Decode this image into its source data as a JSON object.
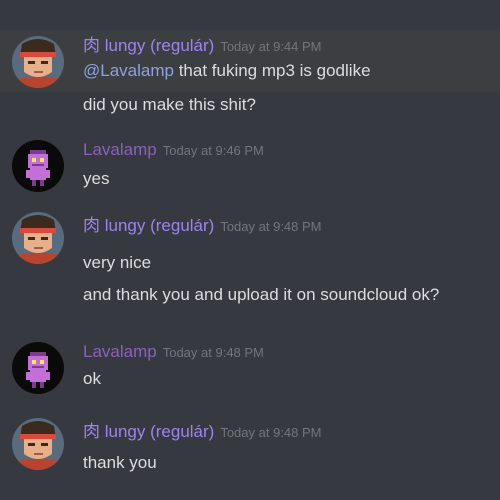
{
  "messages": [
    {
      "author": "肉 lungy (regulár)",
      "timestamp": "Today at 9:44 PM",
      "lines": [
        {
          "mention": "@Lavalamp",
          "text": " that fuking mp3 is godlike"
        },
        {
          "text": "did you make this shit?"
        }
      ]
    },
    {
      "author": "Lavalamp",
      "timestamp": "Today at 9:46 PM",
      "lines": [
        {
          "text": "yes"
        }
      ]
    },
    {
      "author": "肉 lungy (regulár)",
      "timestamp": "Today at 9:48 PM",
      "lines": [
        {
          "text": "very nice"
        },
        {
          "text": "and thank you and upload it on soundcloud ok?"
        }
      ]
    },
    {
      "author": "Lavalamp",
      "timestamp": "Today at 9:48 PM",
      "lines": [
        {
          "text": "ok"
        }
      ]
    },
    {
      "author": "肉 lungy (regulár)",
      "timestamp": "Today at 9:48 PM",
      "lines": [
        {
          "text": "thank you"
        }
      ]
    }
  ],
  "colors": {
    "background": "#36393f",
    "highlight": "#3c3e42",
    "lungy_name": "#9c84ef",
    "lavalamp_name": "#8e5fbe",
    "mention": "#8ea1e1",
    "timestamp": "#72767d",
    "text": "#dcddde"
  },
  "icons": {
    "lungy_avatar": "fighter-portrait-avatar",
    "lavalamp_avatar": "pixel-character-avatar"
  }
}
